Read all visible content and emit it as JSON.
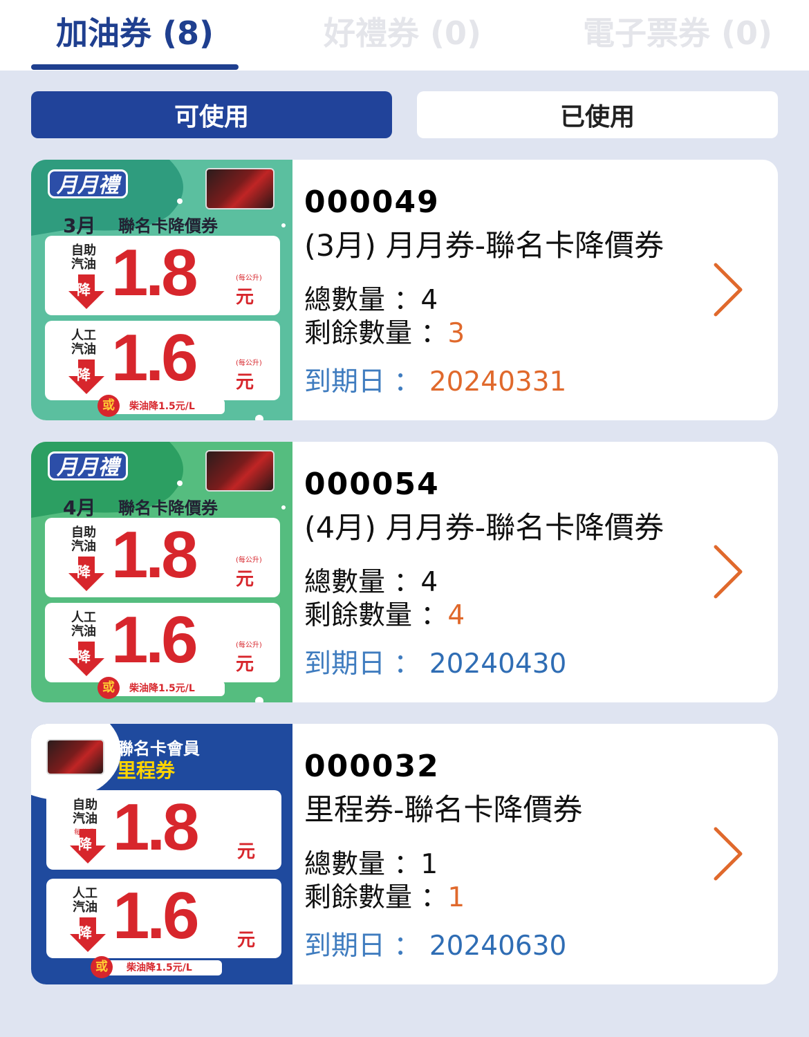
{
  "tabs": [
    {
      "label": "加油券 (8)",
      "active": true
    },
    {
      "label": "好禮券 (0)",
      "active": false
    },
    {
      "label": "電子票券 (0)",
      "active": false
    }
  ],
  "toggle": {
    "available": "可使用",
    "used": "已使用"
  },
  "labels": {
    "total": "總數量 ：",
    "remaining": "剩餘數量 ：",
    "expiry": "到期日 ："
  },
  "colors": {
    "primary": "#21439a",
    "accent_orange": "#e0692c",
    "expiry_blue": "#2f6db4"
  },
  "coupons": [
    {
      "code": "000049",
      "name": "(3月) 月月券-聯名卡降價券",
      "total": "4",
      "remaining": "3",
      "expiry": "20240331",
      "image": {
        "badge": "月月禮",
        "month": "3月",
        "subtitle": "聯名卡降價券",
        "self_label": "自助\n汽油",
        "self_value": "1.8",
        "manual_label": "人工\n汽油",
        "manual_value": "1.6",
        "unit": "元",
        "per_liter": "(每公升)",
        "down": "降",
        "or": "或",
        "diesel": "柴油降1.5元/L"
      }
    },
    {
      "code": "000054",
      "name": "(4月) 月月券-聯名卡降價券",
      "total": "4",
      "remaining": "4",
      "expiry": "20240430",
      "image": {
        "badge": "月月禮",
        "month": "4月",
        "subtitle": "聯名卡降價券",
        "self_label": "自助\n汽油",
        "self_value": "1.8",
        "manual_label": "人工\n汽油",
        "manual_value": "1.6",
        "unit": "元",
        "per_liter": "(每公升)",
        "down": "降",
        "or": "或",
        "diesel": "柴油降1.5元/L"
      }
    },
    {
      "code": "000032",
      "name": "里程券-聯名卡降價券",
      "total": "1",
      "remaining": "1",
      "expiry": "20240630",
      "image": {
        "head1": "聯名卡會員",
        "head2": "里程券",
        "self_label": "自助\n汽油",
        "self_value": "1.8",
        "manual_label": "人工\n汽油",
        "manual_value": "1.6",
        "unit": "元",
        "per_liter": "每公升",
        "down": "降",
        "or": "或",
        "diesel": "柴油降1.5元/L"
      }
    }
  ]
}
